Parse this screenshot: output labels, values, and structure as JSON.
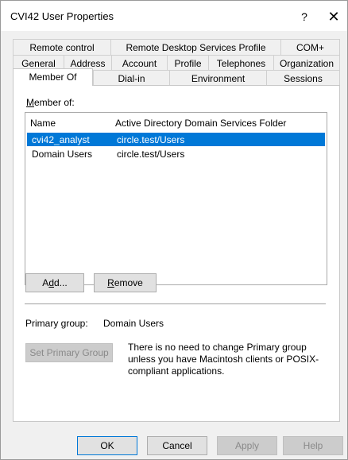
{
  "window": {
    "title": "CVI42 User Properties",
    "help_glyph": "?",
    "close_glyph": "✕"
  },
  "tabs": {
    "row1": [
      "Remote control",
      "Remote Desktop Services Profile",
      "COM+"
    ],
    "row2": [
      "General",
      "Address",
      "Account",
      "Profile",
      "Telephones",
      "Organization"
    ],
    "row3": [
      "Member Of",
      "Dial-in",
      "Environment",
      "Sessions"
    ],
    "active": "Member Of"
  },
  "member_of": {
    "label_prefix": "M",
    "label_rest": "ember of:",
    "columns": [
      "Name",
      "Active Directory Domain Services Folder"
    ],
    "rows": [
      {
        "name": "cvi42_analyst",
        "folder": "circle.test/Users",
        "selected": true
      },
      {
        "name": "Domain Users",
        "folder": "circle.test/Users",
        "selected": false
      }
    ],
    "add_label": "Add...",
    "add_accel": "d",
    "remove_label": "Remove",
    "remove_accel": "R"
  },
  "primary_group": {
    "label": "Primary group:",
    "value": "Domain Users",
    "set_button": "Set Primary Group",
    "note": "There is no need to change Primary group unless you have Macintosh clients or POSIX-compliant applications."
  },
  "buttons": {
    "ok": "OK",
    "cancel": "Cancel",
    "apply": "Apply",
    "help": "Help"
  },
  "colors": {
    "selection": "#0078d7",
    "window_bg": "#f0f0f0"
  }
}
